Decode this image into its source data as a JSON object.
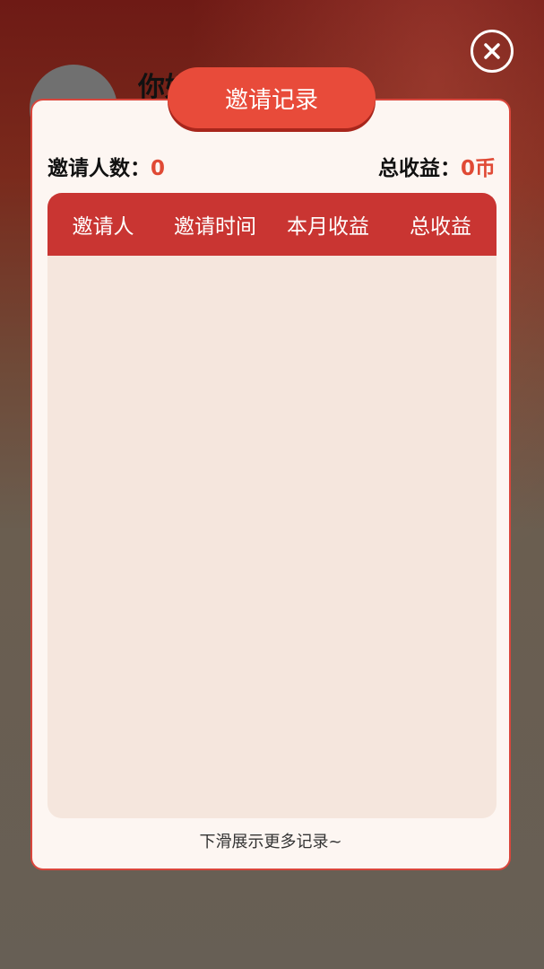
{
  "background": {
    "name_text": "你好"
  },
  "modal": {
    "title": "邀请记录",
    "stats": {
      "invite_count_label": "邀请人数：",
      "invite_count_value": "0",
      "total_income_label": "总收益：",
      "total_income_value": "0币"
    },
    "table": {
      "headers": [
        "邀请人",
        "邀请时间",
        "本月收益",
        "总收益"
      ],
      "rows": []
    },
    "footer_hint": "下滑展示更多记录~"
  },
  "icons": {
    "close": "close-icon"
  },
  "colors": {
    "accent": "#e84b3a",
    "header_red": "#c93532",
    "value_red": "#e04a35",
    "modal_bg": "#fdf6f2",
    "table_bg": "#f5e6dd"
  }
}
